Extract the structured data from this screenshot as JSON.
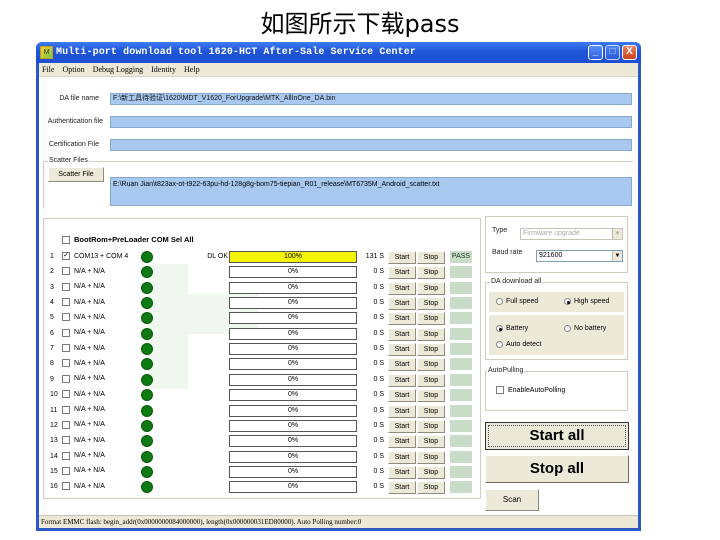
{
  "slide_title": "如图所示下载pass",
  "window": {
    "title": "Multi-port download tool 1620-HCT After-Sale Service Center",
    "controls": {
      "minimize": "_",
      "maximize": "□",
      "close": "X"
    }
  },
  "menu": [
    {
      "label": "File",
      "accel": "F"
    },
    {
      "label": "Option",
      "accel": "O"
    },
    {
      "label": "Debug Logging",
      "accel": ""
    },
    {
      "label": "Identity",
      "accel": "I"
    },
    {
      "label": "Help",
      "accel": "H"
    }
  ],
  "files": {
    "da_label": "DA file name",
    "da_value": "F:\\新工具待验证\\1620\\MDT_V1620_ForUpgrade\\MTK_AllInOne_DA.bin",
    "auth_label": "Authentication file",
    "auth_value": "",
    "cert_label": "Certification File",
    "cert_value": "",
    "scatter_group": "Scatter Files",
    "scatter_button": "Scatter File",
    "scatter_value": "E:\\Ruan Jian\\t823ax-ot-t922-63pu-hd-128g8g-bom75-tiepian_R01_release\\MT6735M_Android_scatter.txt"
  },
  "ports": {
    "sel_all_label": "BootRom+PreLoader COM Sel All",
    "sel_all_checked": false,
    "start_label": "Start",
    "stop_label": "Stop",
    "rows": [
      {
        "index": "1",
        "checked": true,
        "name": "COM13 + COM 4",
        "status": "DL OK",
        "progress": 100,
        "progress_label": "100%",
        "time": "131 S",
        "result": "PASS"
      },
      {
        "index": "2",
        "checked": false,
        "name": "N/A + N/A",
        "status": "",
        "progress": 0,
        "progress_label": "0%",
        "time": "0 S",
        "result": ""
      },
      {
        "index": "3",
        "checked": false,
        "name": "N/A + N/A",
        "status": "",
        "progress": 0,
        "progress_label": "0%",
        "time": "0 S",
        "result": ""
      },
      {
        "index": "4",
        "checked": false,
        "name": "N/A + N/A",
        "status": "",
        "progress": 0,
        "progress_label": "0%",
        "time": "0 S",
        "result": ""
      },
      {
        "index": "5",
        "checked": false,
        "name": "N/A + N/A",
        "status": "",
        "progress": 0,
        "progress_label": "0%",
        "time": "0 S",
        "result": ""
      },
      {
        "index": "6",
        "checked": false,
        "name": "N/A + N/A",
        "status": "",
        "progress": 0,
        "progress_label": "0%",
        "time": "0 S",
        "result": ""
      },
      {
        "index": "7",
        "checked": false,
        "name": "N/A + N/A",
        "status": "",
        "progress": 0,
        "progress_label": "0%",
        "time": "0 S",
        "result": ""
      },
      {
        "index": "8",
        "checked": false,
        "name": "N/A + N/A",
        "status": "",
        "progress": 0,
        "progress_label": "0%",
        "time": "0 S",
        "result": ""
      },
      {
        "index": "9",
        "checked": false,
        "name": "N/A + N/A",
        "status": "",
        "progress": 0,
        "progress_label": "0%",
        "time": "0 S",
        "result": ""
      },
      {
        "index": "10",
        "checked": false,
        "name": "N/A + N/A",
        "status": "",
        "progress": 0,
        "progress_label": "0%",
        "time": "0 S",
        "result": ""
      },
      {
        "index": "11",
        "checked": false,
        "name": "N/A + N/A",
        "status": "",
        "progress": 0,
        "progress_label": "0%",
        "time": "0 S",
        "result": ""
      },
      {
        "index": "12",
        "checked": false,
        "name": "N/A + N/A",
        "status": "",
        "progress": 0,
        "progress_label": "0%",
        "time": "0 S",
        "result": ""
      },
      {
        "index": "13",
        "checked": false,
        "name": "N/A + N/A",
        "status": "",
        "progress": 0,
        "progress_label": "0%",
        "time": "0 S",
        "result": ""
      },
      {
        "index": "14",
        "checked": false,
        "name": "N/A + N/A",
        "status": "",
        "progress": 0,
        "progress_label": "0%",
        "time": "0 S",
        "result": ""
      },
      {
        "index": "15",
        "checked": false,
        "name": "N/A + N/A",
        "status": "",
        "progress": 0,
        "progress_label": "0%",
        "time": "0 S",
        "result": ""
      },
      {
        "index": "16",
        "checked": false,
        "name": "N/A + N/A",
        "status": "",
        "progress": 0,
        "progress_label": "0%",
        "time": "0 S",
        "result": ""
      }
    ]
  },
  "settings": {
    "type_label": "Type",
    "type_value": "Firmware upgrade",
    "baud_label": "Baud rate",
    "baud_value": "921600",
    "da_group": "DA download all",
    "speed_options": [
      {
        "label": "Full speed",
        "selected": false
      },
      {
        "label": "High speed",
        "selected": true
      }
    ],
    "battery_options": [
      {
        "label": "Battery",
        "selected": true
      },
      {
        "label": "No battery",
        "selected": false
      },
      {
        "label": "Auto detect",
        "selected": false
      }
    ],
    "autopolling_group": "AutoPulling",
    "autopolling_label": "EnableAutoPolling",
    "autopolling_checked": false,
    "start_all": "Start all",
    "stop_all": "Stop all",
    "scan": "Scan"
  },
  "statusbar": "Format EMMC flash:   begin_addr(0x0000000084000000), length(0x000000031ED80000). Auto Polling number:0",
  "colors": {
    "progress_fill": "#f4f40a",
    "led_green": "#0e7a12",
    "field_blue": "#a9c8ef",
    "pass_bg": "#c8dcc8",
    "titlebar_blue": "#1f55d8"
  }
}
